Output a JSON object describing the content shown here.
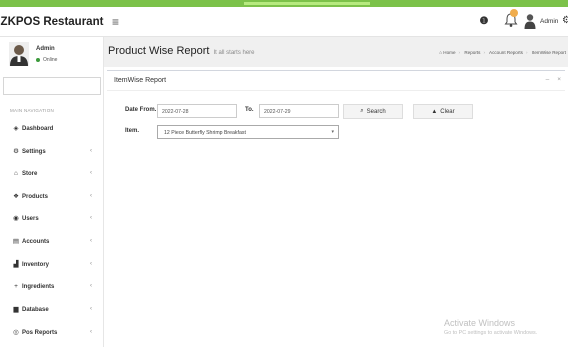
{
  "app": {
    "brand": "ZKPOS Restaurant"
  },
  "navbar": {
    "menu_icon": "hamburger-icon",
    "info_icon": "info-icon",
    "bell_icon": "bell-icon",
    "user_name": "Admin",
    "settings_icon": "gear-icon",
    "accent": "#7cc24a"
  },
  "sidebar": {
    "user": {
      "name": "Admin",
      "status": "Online"
    },
    "header": "MAIN NAVIGATION",
    "items": [
      {
        "label": "Dashboard",
        "icon": "dashboard-icon",
        "has_children": false
      },
      {
        "label": "Settings",
        "icon": "gear-icon",
        "has_children": true
      },
      {
        "label": "Store",
        "icon": "home-icon",
        "has_children": true
      },
      {
        "label": "Products",
        "icon": "cube-icon",
        "has_children": true
      },
      {
        "label": "Users",
        "icon": "user-icon",
        "has_children": true
      },
      {
        "label": "Accounts",
        "icon": "ledger-icon",
        "has_children": true
      },
      {
        "label": "Inventory",
        "icon": "chart-icon",
        "has_children": true
      },
      {
        "label": "Ingredients",
        "icon": "plus-icon",
        "has_children": true
      },
      {
        "label": "Database",
        "icon": "database-icon",
        "has_children": true
      },
      {
        "label": "Pos Reports",
        "icon": "eye-icon",
        "has_children": true
      }
    ]
  },
  "page": {
    "title": "Product Wise Report",
    "subtitle": "It all starts here",
    "breadcrumb": [
      "Home",
      "Reports",
      "Account Reports",
      "ItemWise Report"
    ]
  },
  "report": {
    "box_title": "ItemWise Report",
    "date_from_label": "Date From.",
    "date_from_value": "2022-07-28",
    "to_label": "To.",
    "to_value": "2022-07-29",
    "search_label": "Search",
    "clear_label": "Clear",
    "item_label": "Item.",
    "item_selected": "12 Piece Butterfly Shrimp Breakfast"
  },
  "watermark": {
    "title": "Activate Windows",
    "subtitle": "Go to PC settings to activate Windows."
  }
}
